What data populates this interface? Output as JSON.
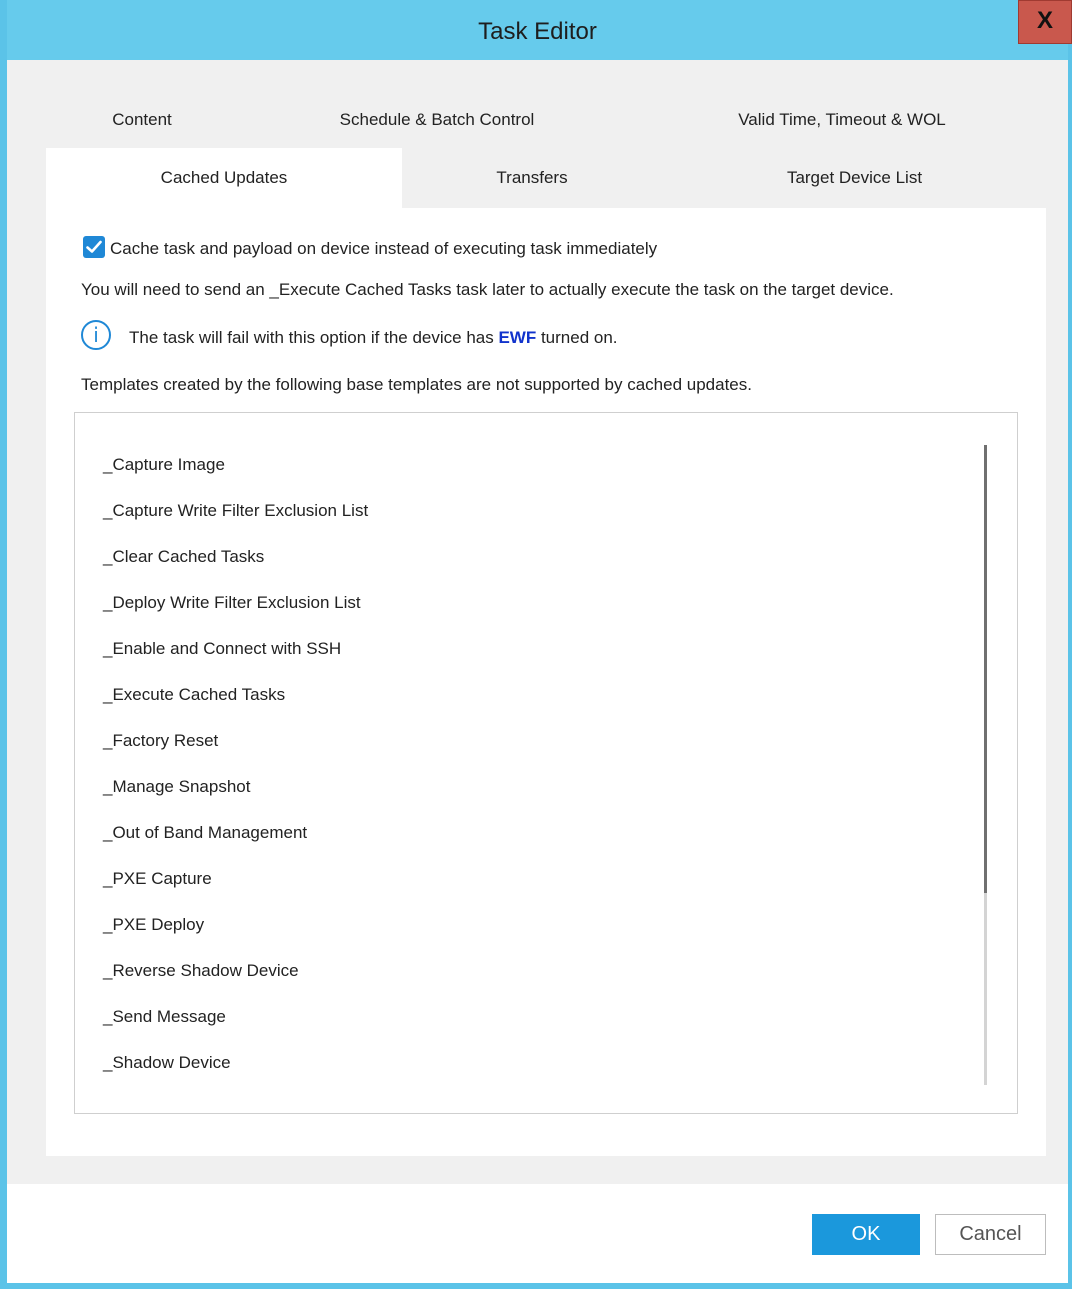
{
  "window": {
    "title": "Task Editor",
    "close_label": "X"
  },
  "tabs": {
    "row1": [
      {
        "label": "Content"
      },
      {
        "label": "Schedule & Batch Control"
      },
      {
        "label": "Valid Time, Timeout & WOL"
      }
    ],
    "row2": [
      {
        "label": "Cached Updates",
        "selected": true
      },
      {
        "label": "Transfers",
        "selected": false
      },
      {
        "label": "Target Device List",
        "selected": false
      }
    ]
  },
  "panel": {
    "cache_checkbox": {
      "checked": true,
      "label": "Cache task and payload on device instead of executing task immediately"
    },
    "note": "You will need to send an _Execute Cached Tasks task later to actually execute the task on the target device.",
    "info": {
      "icon": "info-icon",
      "before": "The task will fail with this option if the device has ",
      "highlight": "EWF",
      "after": " turned on."
    },
    "templates_intro": "Templates created by the following base templates are not supported by cached updates.",
    "templates": [
      "_Capture Image",
      "_Capture Write Filter Exclusion List",
      "_Clear Cached Tasks",
      "_Deploy Write Filter Exclusion List",
      "_Enable and Connect with SSH",
      "_Execute Cached Tasks",
      "_Factory Reset",
      "_Manage Snapshot",
      "_Out of Band Management",
      "_PXE Capture",
      "_PXE Deploy",
      "_Reverse Shadow Device",
      "_Send Message",
      "_Shadow Device"
    ]
  },
  "footer": {
    "ok_label": "OK",
    "cancel_label": "Cancel"
  },
  "colors": {
    "title_bar": "#66cbec",
    "accent": "#1f88d6",
    "ok_button": "#1b98dc",
    "close_button": "#c9584d",
    "ewf_highlight": "#1133cc"
  }
}
